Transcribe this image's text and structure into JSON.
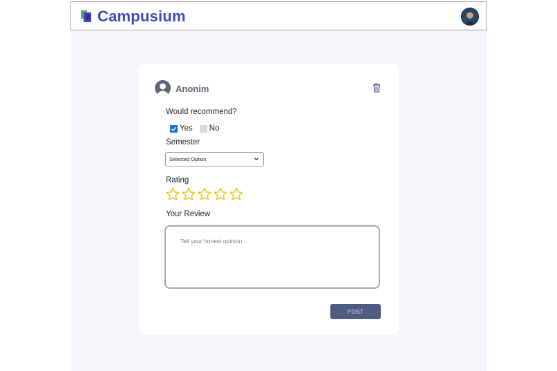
{
  "header": {
    "brand_name": "Campusium",
    "brand_color": "#3d4bb8",
    "logo_icon": "book-stack-logo",
    "avatar_icon": "user-profile-photo"
  },
  "review_form": {
    "author": {
      "name": "Anonim",
      "avatar_icon": "user-silhouette-icon"
    },
    "delete_icon": "trash-icon",
    "recommend": {
      "question": "Would recommend?",
      "options": [
        {
          "label": "Yes",
          "checked": true
        },
        {
          "label": "No",
          "checked": false
        }
      ]
    },
    "semester": {
      "label": "Semester",
      "selected": "Selected Option"
    },
    "rating": {
      "label": "Rating",
      "max": 5,
      "value": 0,
      "star_color": "#f2c21b"
    },
    "review": {
      "label": "Your Review",
      "placeholder": "Tell your honest opinion..."
    },
    "post_button": "POST",
    "post_button_color": "#4f5b80"
  }
}
